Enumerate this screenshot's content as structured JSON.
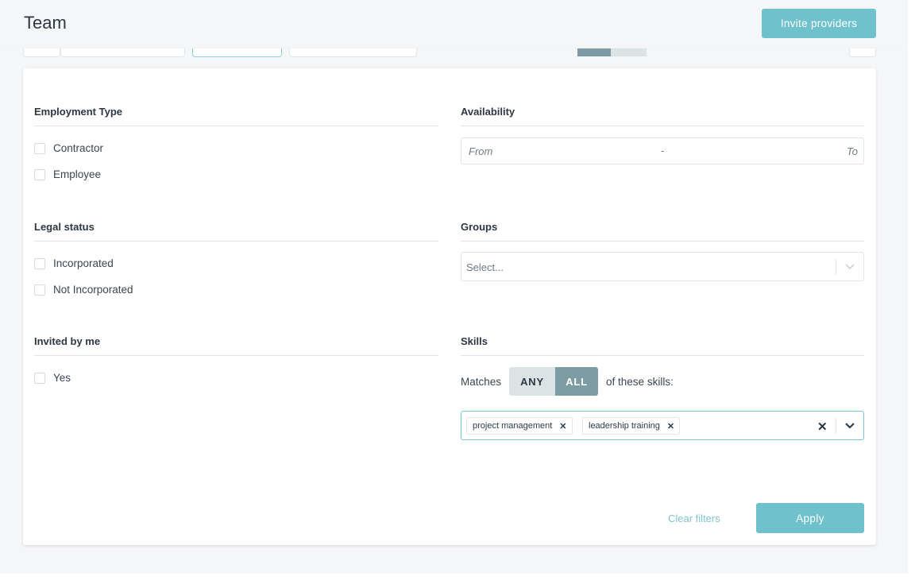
{
  "header": {
    "title": "Team",
    "invite_label": "Invite providers"
  },
  "filters": {
    "employment_type": {
      "title": "Employment Type",
      "options": [
        "Contractor",
        "Employee"
      ]
    },
    "legal_status": {
      "title": "Legal status",
      "options": [
        "Incorporated",
        "Not Incorporated"
      ]
    },
    "invited_by_me": {
      "title": "Invited by me",
      "options": [
        "Yes"
      ]
    },
    "availability": {
      "title": "Availability",
      "from_placeholder": "From",
      "separator": "-",
      "to_placeholder": "To"
    },
    "groups": {
      "title": "Groups",
      "placeholder": "Select..."
    },
    "skills": {
      "title": "Skills",
      "matches_label": "Matches",
      "any_label": "ANY",
      "all_label": "ALL",
      "selected_mode": "ALL",
      "suffix_label": "of these skills:",
      "tags": [
        "project management",
        "leadership training"
      ]
    }
  },
  "actions": {
    "clear_label": "Clear filters",
    "apply_label": "Apply"
  },
  "colors": {
    "accent": "#6fc1cc",
    "toggle_active": "#7d9ba2",
    "toggle_inactive": "#dbe3e5"
  }
}
